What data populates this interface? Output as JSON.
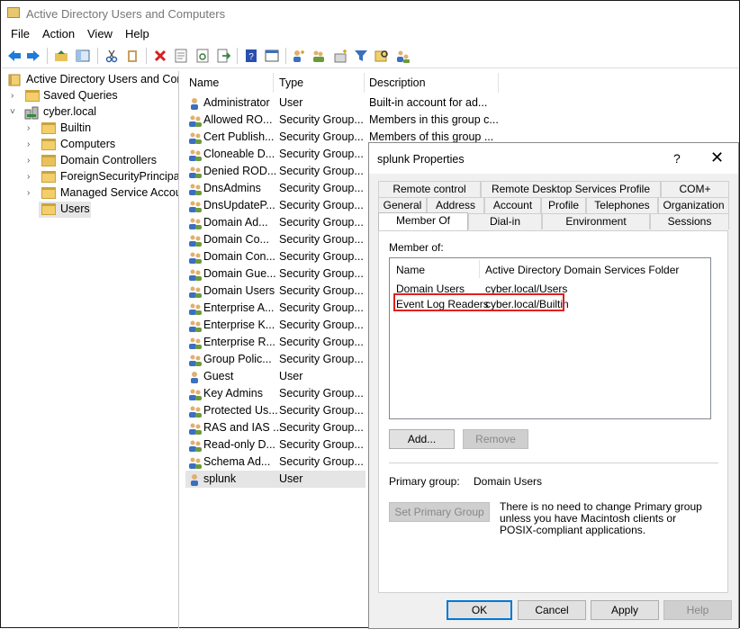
{
  "window": {
    "title": "Active Directory Users and Computers"
  },
  "menu": [
    "File",
    "Action",
    "View",
    "Help"
  ],
  "tree": {
    "root": "Active Directory Users and Com",
    "saved_queries": "Saved Queries",
    "domain": "cyber.local",
    "children": [
      "Builtin",
      "Computers",
      "Domain Controllers",
      "ForeignSecurityPrincipals",
      "Managed Service Accour",
      "Users"
    ]
  },
  "list": {
    "columns": [
      "Name",
      "Type",
      "Description"
    ],
    "rows": [
      {
        "name": "Administrator",
        "type": "User",
        "desc": "Built-in account for ad..."
      },
      {
        "name": "Allowed RO...",
        "type": "Security Group...",
        "desc": "Members in this group c..."
      },
      {
        "name": "Cert Publish...",
        "type": "Security Group...",
        "desc": "Members of this group ..."
      },
      {
        "name": "Cloneable D...",
        "type": "Security Group...",
        "desc": ""
      },
      {
        "name": "Denied ROD...",
        "type": "Security Group...",
        "desc": ""
      },
      {
        "name": "DnsAdmins",
        "type": "Security Group...",
        "desc": ""
      },
      {
        "name": "DnsUpdateP...",
        "type": "Security Group...",
        "desc": ""
      },
      {
        "name": "Domain Ad...",
        "type": "Security Group...",
        "desc": ""
      },
      {
        "name": "Domain Co...",
        "type": "Security Group...",
        "desc": ""
      },
      {
        "name": "Domain Con...",
        "type": "Security Group...",
        "desc": ""
      },
      {
        "name": "Domain Gue...",
        "type": "Security Group...",
        "desc": ""
      },
      {
        "name": "Domain Users",
        "type": "Security Group...",
        "desc": ""
      },
      {
        "name": "Enterprise A...",
        "type": "Security Group...",
        "desc": ""
      },
      {
        "name": "Enterprise K...",
        "type": "Security Group...",
        "desc": ""
      },
      {
        "name": "Enterprise R...",
        "type": "Security Group...",
        "desc": ""
      },
      {
        "name": "Group Polic...",
        "type": "Security Group...",
        "desc": ""
      },
      {
        "name": "Guest",
        "type": "User",
        "desc": ""
      },
      {
        "name": "Key Admins",
        "type": "Security Group...",
        "desc": ""
      },
      {
        "name": "Protected Us...",
        "type": "Security Group...",
        "desc": ""
      },
      {
        "name": "RAS and IAS ...",
        "type": "Security Group...",
        "desc": ""
      },
      {
        "name": "Read-only D...",
        "type": "Security Group...",
        "desc": ""
      },
      {
        "name": "Schema Ad...",
        "type": "Security Group...",
        "desc": ""
      },
      {
        "name": "splunk",
        "type": "User",
        "desc": ""
      }
    ]
  },
  "dialog": {
    "title": "splunk Properties",
    "help_glyph": "?",
    "close_glyph": "✕",
    "tabs_row1": [
      "Remote control",
      "Remote Desktop Services Profile",
      "COM+"
    ],
    "tabs_row2": [
      "General",
      "Address",
      "Account",
      "Profile",
      "Telephones",
      "Organization"
    ],
    "tabs_row3": [
      "Member Of",
      "Dial-in",
      "Environment",
      "Sessions"
    ],
    "member_of_label": "Member of:",
    "member_columns": [
      "Name",
      "Active Directory Domain Services Folder"
    ],
    "members": [
      {
        "name": "Domain Users",
        "folder": "cyber.local/Users"
      },
      {
        "name": "Event Log Readers",
        "folder": "cyber.local/Builtin"
      }
    ],
    "add_button": "Add...",
    "remove_button": "Remove",
    "primary_group_label": "Primary group:",
    "primary_group_value": "Domain Users",
    "set_primary_button": "Set Primary Group",
    "primary_note": "There is no need to change Primary group unless you have Macintosh clients or POSIX-compliant applications.",
    "ok_button": "OK",
    "cancel_button": "Cancel",
    "apply_button": "Apply",
    "help_button": "Help"
  },
  "colors": {
    "highlight": "#e02020",
    "accent": "#0078d7",
    "folder": "#f2cf6b"
  }
}
